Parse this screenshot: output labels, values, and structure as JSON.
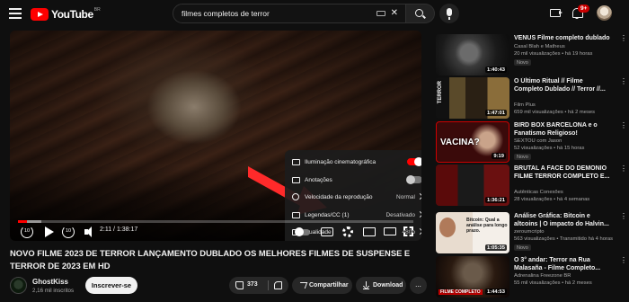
{
  "masthead": {
    "logo_text": "YouTube",
    "logo_country": "BR",
    "search_query": "filmes completos de terror",
    "notification_count": "9+"
  },
  "player": {
    "time_display": "2:11 / 1:38:17",
    "progress_fraction": 0.0222,
    "buffer_fraction": 0.06,
    "rewind_seconds": "10",
    "forward_seconds": "10",
    "settings": [
      {
        "label": "Iluminação cinematográfica",
        "type": "toggle",
        "state": "on",
        "icon": "ambient-icon"
      },
      {
        "label": "Anotações",
        "type": "toggle",
        "state": "off",
        "icon": "annotations-icon"
      },
      {
        "label": "Velocidade da reprodução",
        "type": "value",
        "value": "Normal",
        "icon": "speed-icon"
      },
      {
        "label": "Legendas/CC (1)",
        "type": "value",
        "value": "Desativado",
        "icon": "cc-icon"
      },
      {
        "label": "Qualidade",
        "type": "value",
        "value": "480p",
        "icon": "quality-icon"
      }
    ],
    "accent_color": "#ff0000"
  },
  "video": {
    "title": "NOVO FILME 2023 DE TERROR LANÇAMENTO DUBLADO OS MELHORES FILMES DE SUSPENSE E TERROR DE 2023 EM HD",
    "channel": "GhostKiss",
    "subscribers": "2,16 mil inscritos",
    "subscribe_label": "Inscrever-se",
    "like_count": "373",
    "share_label": "Compartilhar",
    "download_label": "Download",
    "more_label": "..."
  },
  "recommendations": [
    {
      "title": "VENUS Filme completo dublado",
      "channel": "Casal Blah e Matheus",
      "meta": "20 mil visualizações • há 19 horas",
      "badge": "Novo",
      "duration": "1:40:43",
      "thumb_text": ""
    },
    {
      "title": "O Último Ritual // Filme Completo Dublado // Terror //...",
      "channel": "Film Plus",
      "meta": "659 mil visualizações • há 2 meses",
      "badge": "",
      "duration": "1:47:01",
      "thumb_text": "TERROR"
    },
    {
      "title": "BIRD BOX BARCELONA e o Fanatismo Religioso!",
      "channel": "SEXTOU com Jason",
      "meta": "52 visualizações • há 15 horas",
      "badge": "Novo",
      "duration": "9:19",
      "thumb_text": "VACINA?"
    },
    {
      "title": "BRUTAL A FACE DO DEMONIO FILME TERROR COMPLETO E...",
      "channel": "Autênticas Conexões",
      "meta": "28 visualizações • há 4 semanas",
      "badge": "",
      "duration": "1:36:21",
      "thumb_text": ""
    },
    {
      "title": "Análise Gráfica: Bitcoin e altcoins | O impacto do Halvin...",
      "channel": "zeroumcripto",
      "meta": "563 visualizações • Transmitido há 4 horas",
      "badge": "Novo",
      "duration": "1:05:35",
      "thumb_text": "Bitcoin: Qual a análise para longo prazo."
    },
    {
      "title": "O 3° andar: Terror na Rua Malasaña - Filme Completo...",
      "channel": "Adrenalina Freezone BR",
      "meta": "55 mil visualizações • há 2 meses",
      "badge": "",
      "duration": "1:44:53",
      "thumb_text": "FILME COMPLETO"
    }
  ]
}
